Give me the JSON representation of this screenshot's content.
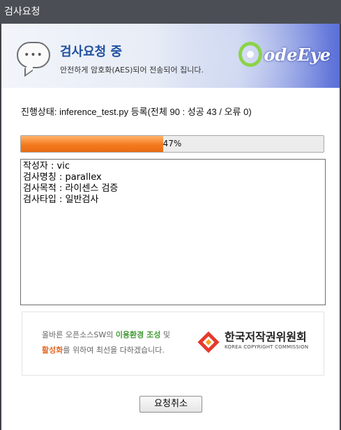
{
  "window": {
    "title": "검사요청"
  },
  "header": {
    "title": "검사요청 중",
    "subtitle": "안전하게 암호화(AES)되어 전송되어 집니다.",
    "logo_text": "odeEye"
  },
  "status": {
    "text": "진행상태: inference_test.py 등록(전체 90 : 성공 43 / 오류 0)"
  },
  "progress": {
    "percent": 47,
    "label": "47%",
    "color": "#f47a1f"
  },
  "log": {
    "lines": [
      "작성자 : vic",
      "검사명칭 : parallex",
      "검사목적 : 라이센스 검증",
      "검사타입 : 일반검사"
    ]
  },
  "banner": {
    "line1_a": "올바른 오픈소스SW의 ",
    "line1_b": "이용환경 조성",
    "line1_c": " 및",
    "line2_a": "활성화",
    "line2_b": "를 위하여 최선을 다하겠습니다.",
    "org_name": "한국저작권위원회",
    "org_sub": "KOREA COPYRIGHT COMMISSION"
  },
  "actions": {
    "cancel_label": "요청취소"
  }
}
